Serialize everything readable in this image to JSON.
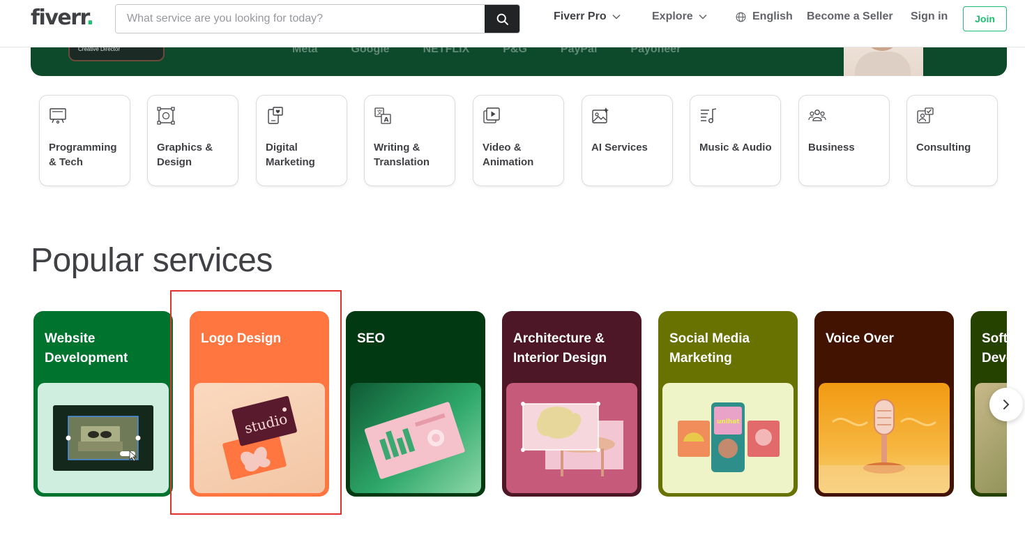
{
  "header": {
    "logo_text": "fiverr",
    "logo_dot": ".",
    "search": {
      "placeholder": "What service are you looking for today?"
    },
    "nav": {
      "fiverr_pro": "Fiverr Pro",
      "explore": "Explore",
      "language": "English",
      "become_seller": "Become a Seller",
      "sign_in": "Sign in",
      "join": "Join"
    }
  },
  "hero": {
    "card_caption": "Creative Director",
    "brands": [
      "Meta",
      "Google",
      "NETFLIX",
      "P&G",
      "PayPal",
      "Payoneer"
    ]
  },
  "categories": [
    {
      "label": "Programming & Tech",
      "icon": "monitor-icon"
    },
    {
      "label": "Graphics & Design",
      "icon": "design-frame-icon"
    },
    {
      "label": "Digital Marketing",
      "icon": "phone-heart-icon"
    },
    {
      "label": "Writing & Translation",
      "icon": "translate-icon"
    },
    {
      "label": "Video & Animation",
      "icon": "video-play-icon"
    },
    {
      "label": "AI Services",
      "icon": "ai-image-icon"
    },
    {
      "label": "Music & Audio",
      "icon": "music-note-icon"
    },
    {
      "label": "Business",
      "icon": "people-icon"
    },
    {
      "label": "Consulting",
      "icon": "consulting-icon"
    }
  ],
  "popular": {
    "title": "Popular services",
    "services": [
      {
        "label": "Website Development",
        "color": "#00732e",
        "img_bg": "#cfeee0"
      },
      {
        "label": "Logo Design",
        "color": "#ff7640",
        "img_bg": "#f6d2b6"
      },
      {
        "label": "SEO",
        "color": "#003912",
        "img_bg": "#1f7a4d"
      },
      {
        "label": "Architecture & Interior Design",
        "color": "#4d1727",
        "img_bg": "#c65a7a"
      },
      {
        "label": "Social Media Marketing",
        "color": "#687200",
        "img_bg": "#eef4c8"
      },
      {
        "label": "Voice Over",
        "color": "#421300",
        "img_bg": "#f2a41e"
      },
      {
        "label": "Software Development",
        "color": "#254200",
        "img_bg": "#6e7a3a"
      }
    ]
  },
  "colors": {
    "brand_green": "#1dbf73",
    "text_dark": "#404145",
    "highlight_red": "#e0322d"
  }
}
